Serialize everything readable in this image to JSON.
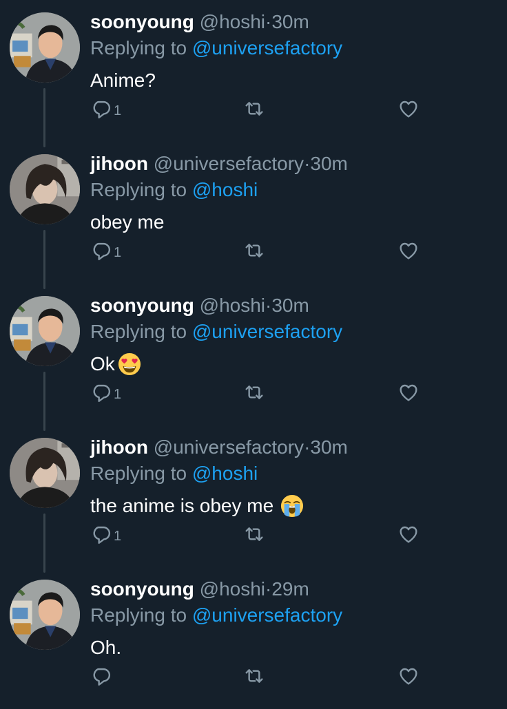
{
  "tweets": [
    {
      "author": "soonyoung",
      "handle": "@hoshi",
      "dot": "·",
      "time": "30m",
      "replying_prefix": "Replying to",
      "replying_handle": "@universefactory",
      "text": "Anime?",
      "reply_count": "1",
      "avatar": "soonyoung-avatar"
    },
    {
      "author": "jihoon",
      "handle": "@universefactory",
      "dot": "·",
      "time": "30m",
      "replying_prefix": "Replying to",
      "replying_handle": "@hoshi",
      "text": "obey me",
      "reply_count": "1",
      "avatar": "jihoon-avatar"
    },
    {
      "author": "soonyoung",
      "handle": "@hoshi",
      "dot": "·",
      "time": "30m",
      "replying_prefix": "Replying to",
      "replying_handle": "@universefactory",
      "text": "Ok",
      "emoji": "heart-eyes-emoji",
      "reply_count": "1",
      "avatar": "soonyoung-avatar"
    },
    {
      "author": "jihoon",
      "handle": "@universefactory",
      "dot": "·",
      "time": "30m",
      "replying_prefix": "Replying to",
      "replying_handle": "@hoshi",
      "text": "the anime is obey me",
      "emoji": "loudly-crying-emoji",
      "reply_count": "1",
      "avatar": "jihoon-avatar"
    },
    {
      "author": "soonyoung",
      "handle": "@hoshi",
      "dot": "·",
      "time": "29m",
      "replying_prefix": "Replying to",
      "replying_handle": "@universefactory",
      "text": "Oh.",
      "reply_count": "",
      "avatar": "soonyoung-avatar"
    }
  ],
  "icons": {
    "reply": "reply-icon",
    "retweet": "retweet-icon",
    "like": "heart-icon"
  },
  "colors": {
    "background": "#15202b",
    "secondary_text": "#8899a6",
    "link": "#1da1f2",
    "thread_line": "#38444d"
  }
}
